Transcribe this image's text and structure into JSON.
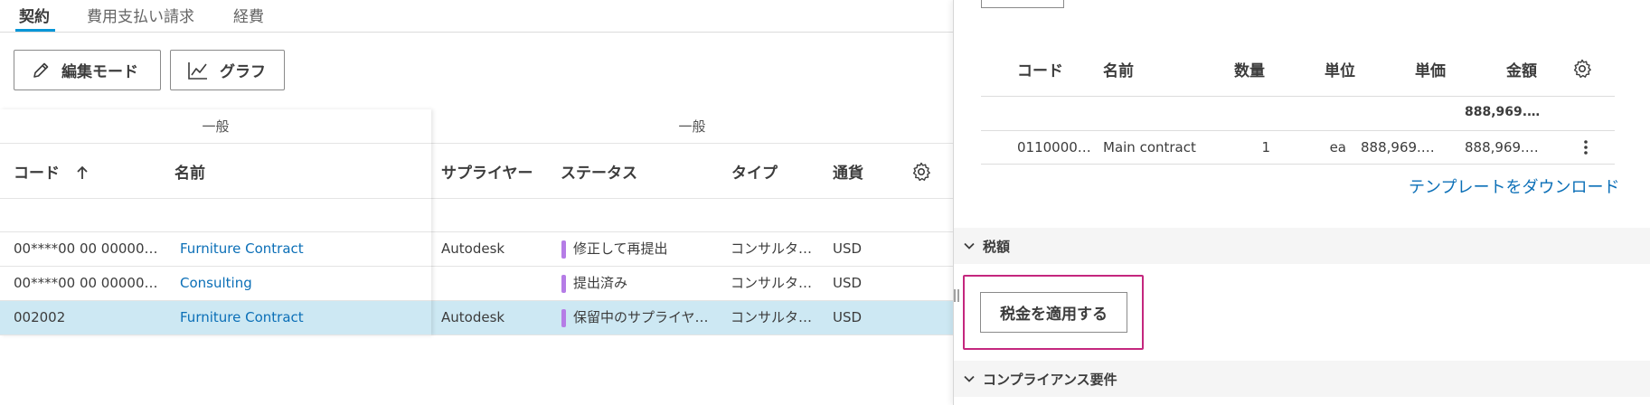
{
  "tabs": [
    "契約",
    "費用支払い請求",
    "経費"
  ],
  "toolbar": {
    "edit_mode": "編集モード",
    "graph": "グラフ"
  },
  "grid": {
    "groups": [
      "一般",
      "一般"
    ],
    "columns": {
      "code": "コード",
      "name": "名前",
      "supplier": "サプライヤー",
      "status": "ステータス",
      "type": "タイプ",
      "currency": "通貨"
    },
    "rows": [
      {
        "code": "00****00 00 000002…",
        "name": "Furniture Contract",
        "supplier": "Autodesk",
        "status": "修正して再提出",
        "type": "コンサルタ…",
        "currency": "USD"
      },
      {
        "code": "00****00 00 000002…",
        "name": "Consulting",
        "supplier": "",
        "status": "提出済み",
        "type": "コンサルタ…",
        "currency": "USD"
      },
      {
        "code": "002002",
        "name": "Furniture Contract",
        "supplier": "Autodesk",
        "status": "保留中のサプライヤ…",
        "type": "コンサルタ…",
        "currency": "USD"
      }
    ],
    "selected_row": 2,
    "status_color": "#b57ce6"
  },
  "line_items": {
    "columns": {
      "code": "コード",
      "name": "名前",
      "qty": "数量",
      "unit": "単位",
      "unit_price": "単価",
      "amount": "金額"
    },
    "total": "888,969.…",
    "rows": [
      {
        "code": "0110000…",
        "name": "Main contract",
        "qty": "1",
        "unit": "ea",
        "unit_price": "888,969.…",
        "amount": "888,969.…"
      }
    ]
  },
  "download_template": "テンプレートをダウンロード",
  "sections": {
    "tax": "税額",
    "compliance": "コンプライアンス要件"
  },
  "apply_tax_button": "税金を適用する",
  "colors": {
    "accent": "#0696d7",
    "link": "#0b6fb7",
    "selected_row": "#cde8f3",
    "highlight": "#c4277e"
  }
}
